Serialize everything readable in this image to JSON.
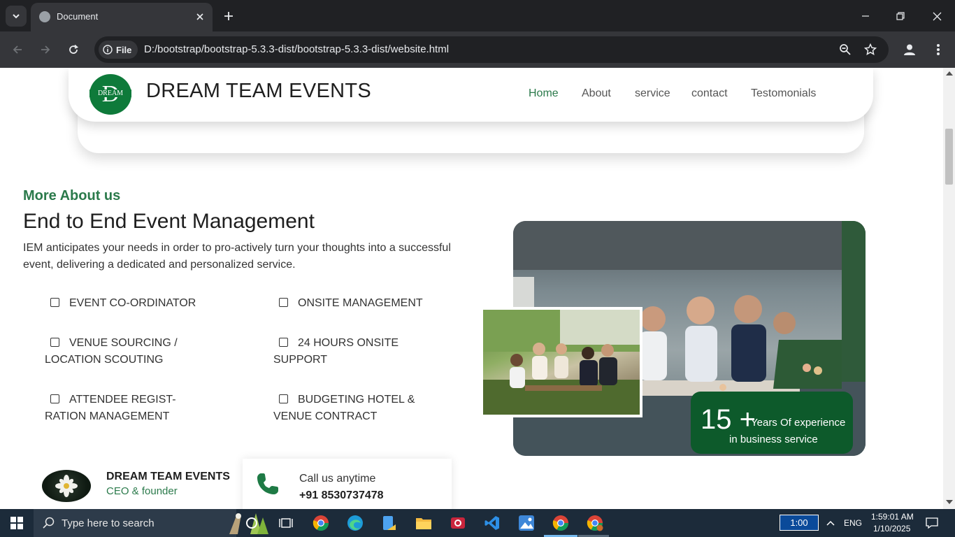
{
  "browser": {
    "tab_title": "Document",
    "file_chip": "File",
    "url": "D:/bootstrap/bootstrap-5.3.3-dist/bootstrap-5.3.3-dist/website.html"
  },
  "navbar": {
    "logo_text": "DREAM",
    "brand": "DREAM TEAM EVENTS",
    "links": [
      "Home",
      "About",
      "service",
      "contact",
      "Testomonials"
    ]
  },
  "about": {
    "subtitle": "More About us",
    "title": "End to End Event Management",
    "paragraph": "IEM anticipates your needs in order to pro-actively turn your thoughts into a successful event, delivering a dedicated and personalized service.",
    "features": [
      "EVENT CO-ORDINATOR",
      "ONSITE MANAGEMENT",
      "VENUE SOURCING / LOCATION SCOUTING",
      "24 HOURS ONSITE SUPPORT",
      "ATTENDEE REGIST- RATION MANAGEMENT",
      "BUDGETING HOTEL & VENUE CONTRACT"
    ],
    "experience_number": "15",
    "experience_plus": "+",
    "experience_line1": "Years Of experience",
    "experience_line2": "in business service"
  },
  "founder": {
    "name": "DREAM TEAM EVENTS",
    "role": "CEO & founder"
  },
  "contact": {
    "label": "Call us anytime",
    "phone": "+91 8530737478"
  },
  "taskbar": {
    "search_placeholder": "Type here to search",
    "tray_box": "1:00",
    "language": "ENG",
    "time": "1:59:01 AM",
    "date": "1/10/2025"
  },
  "colors": {
    "accent_green": "#2b7a4b",
    "badge_green": "#0d5a2b",
    "chrome_dark": "#202124",
    "taskbar": "#1c2b3a"
  }
}
